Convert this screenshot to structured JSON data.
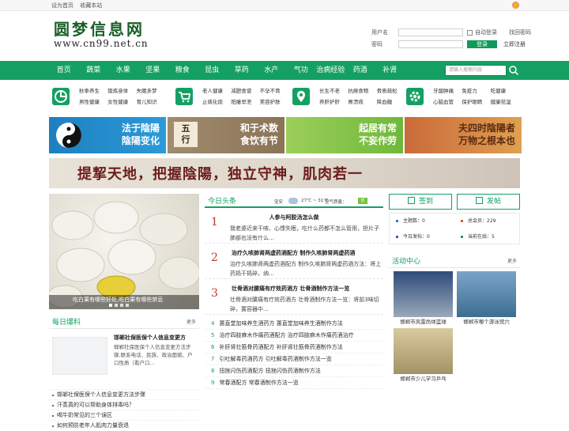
{
  "topbar": {
    "homepage": "设为首页",
    "favorite": "收藏本站"
  },
  "logo": {
    "title": "圆梦信息网",
    "url": "www.cn99.net.cn"
  },
  "login": {
    "username_label": "用户名",
    "password_label": "密码",
    "auto_login": "自动登录",
    "forgot": "找回密码",
    "login_btn": "登录",
    "register": "立即注册"
  },
  "nav": {
    "items": [
      "首页",
      "蔬菜",
      "水果",
      "坚果",
      "粮食",
      "昆虫",
      "草药",
      "水产",
      "气功",
      "治病经验",
      "药酒",
      "补肾"
    ],
    "search_placeholder": "请输入搜索内容"
  },
  "cats": [
    {
      "icon": "chart-pie-icon",
      "items": [
        "秋季养生",
        "锻炼身体",
        "失眠多梦",
        "男性健康",
        "女性健康",
        "育儿知识"
      ]
    },
    {
      "icon": "cart-icon",
      "items": [
        "老人健康",
        "减肥食谱",
        "不孕不育",
        "止咳化痰",
        "阳痿早泄",
        "美容护肤"
      ]
    },
    {
      "icon": "location-icon",
      "items": [
        "长生不老",
        "抗癌食物",
        "骨质疏松",
        "养肝护肝",
        "胃溃疡",
        "降血糖"
      ]
    },
    {
      "icon": "gear-icon",
      "items": [
        "牙龈肿痛",
        "免疫力",
        "吃健康",
        "心脑血管",
        "保护眼睛",
        "健康祛湿"
      ]
    }
  ],
  "banners": [
    {
      "line1": "法于陰陽",
      "line2": "陰陽变化"
    },
    {
      "line1": "和于术数",
      "line2": "食饮有节"
    },
    {
      "line1": "起居有常",
      "line2": "不妄作劳"
    },
    {
      "line1": "夫四时陰陽者",
      "line2": "万物之根本也"
    }
  ],
  "big_banner": "提挈天地，把握陰陽，独立守神，肌肉若一",
  "slider": {
    "caption": "吃白果有哪些好处,吃白果有哪些禁忌"
  },
  "baoliao": {
    "title": "每日爆料",
    "more": "更多",
    "feature_title": "邯郸社保医保个人信息变更方",
    "feature_desc": "邯郸社保医保个人信息变更方法步骤,联系电话、民族、政治面貌、户口性质（看户口...",
    "list": [
      "邯郸社保医保个人信息变更方法步骤",
      "汗蒸真的可以帮助身体排毒吗？",
      "喝牛奶常见的三个误区",
      "如何预防老年人肌肉力量衰退"
    ]
  },
  "today": {
    "title": "今日头条",
    "city": "宝安",
    "weather": "27℃ ~ 31℃",
    "air_label": "空气质量：",
    "air": "优",
    "news": [
      {
        "num": "1",
        "title": "人参与阿胶汤怎么做",
        "desc": "我老婆近来干咳、心悸失眠，吃什么药都不怎么管用，担片子肺部也没有什么..."
      },
      {
        "num": "2",
        "title": "治疗久咳肺肾两虚药酒配方 制作久咳肺肾两虚药酒",
        "desc": "治疗久咳肺肾两虚药酒配方 制作久咳肺肾两虚药酒方法：将上药捣干捣碎，纳..."
      },
      {
        "num": "3",
        "title": "壮骨酒对腰痛有疗效药酒方 壮骨酒制作方法一览",
        "desc": "壮骨酒对腰痛有疗效药酒方 壮骨酒制作方法一览：将前3味切碎，置容器中..."
      }
    ],
    "list": [
      {
        "num": "4",
        "text": "蕙直堂加味养生酒药方 蕙直堂加味养生酒制作方法"
      },
      {
        "num": "5",
        "text": "治疗四肢麻木作痛药酒配方 治疗四肢麻木作痛药酒治疗"
      },
      {
        "num": "6",
        "text": "补肝肾壮筋骨药酒配方 补肝肾壮筋骨药酒制作方法"
      },
      {
        "num": "7",
        "text": "引吐解毒药酒药方 引吐解毒药酒制作方法一览"
      },
      {
        "num": "8",
        "text": "扭挫闪伤药酒配方 扭挫闪伤药酒制作方法"
      },
      {
        "num": "9",
        "text": "常春酒配方 常春酒制作方法一览"
      }
    ]
  },
  "right": {
    "signin": "签到",
    "post": "发帖",
    "stats": [
      {
        "label": "主题数：",
        "value": "0",
        "color": "#2a7ae4"
      },
      {
        "label": "总会员：",
        "value": "229",
        "color": "#e4572e"
      },
      {
        "label": "今日发帖：",
        "value": "0",
        "color": "#7b3fb6"
      },
      {
        "label": "当前在线：",
        "value": "5",
        "color": "#15a063"
      }
    ],
    "huodong_title": "活动中心",
    "huodong_more": "更多",
    "activities": [
      "邯郸市风雷尚体篮球",
      "邯郸市嘟个游泳馆穴",
      "邯郸市少儿学习乒乓"
    ]
  },
  "colors": {
    "brand": "#15a063",
    "accent_red": "#c0392b"
  }
}
